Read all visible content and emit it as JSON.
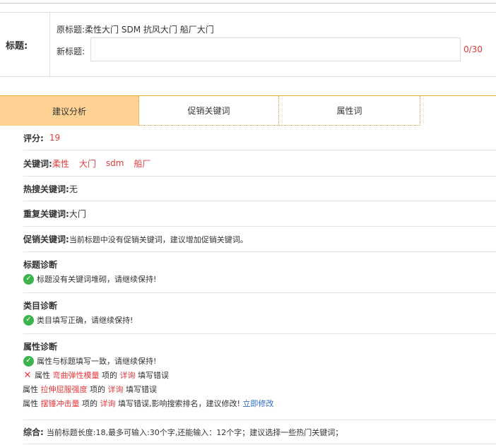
{
  "title_section": {
    "label": "标题:",
    "original_label": "原标题:",
    "original_value": "柔性大门 SDM 抗风大门 船厂大门",
    "new_label": "新标题:",
    "new_value": "",
    "new_placeholder": "",
    "counter": "0/30"
  },
  "tabs": [
    {
      "label": "建议分析",
      "active": true
    },
    {
      "label": "促销关键词",
      "active": false
    },
    {
      "label": "属性词",
      "active": false
    }
  ],
  "score": {
    "label": "评分:",
    "value": "19"
  },
  "keywords": {
    "label": "关键词:",
    "items": [
      "柔性",
      "大门",
      "sdm",
      "船厂"
    ]
  },
  "hot_keywords": {
    "label": "热搜关键词:",
    "value": "无"
  },
  "repeat_keywords": {
    "label": "重复关键词:",
    "value": "大门"
  },
  "promo_keywords": {
    "label": "促销关键词:",
    "value": "当前标题中没有促销关键词，建议增加促销关键词。"
  },
  "title_diag": {
    "heading": "标题诊断",
    "message": "标题没有关键词堆砌，请继续保持!"
  },
  "category_diag": {
    "heading": "类目诊断",
    "message": "类目填写正确，请继续保持!"
  },
  "attr_diag": {
    "heading": "属性诊断",
    "ok_message": "属性与标题填写一致，请继续保持!",
    "prefix": "属性",
    "mid": "项的",
    "detail": "详询",
    "errors": [
      {
        "attr": "弯曲弹性模量",
        "suffix": "填写错误"
      },
      {
        "attr": "拉伸屈服强度",
        "suffix": "填写错误"
      },
      {
        "attr": "摆锤冲击量",
        "suffix": "填写错误,影响搜索排名，建议修改!"
      }
    ],
    "fix_link": "立即修改"
  },
  "summary": {
    "label": "综合:",
    "value": "当前标题长度:18,最多可输入:30个字,还能输入：12个字；建议选择一些热门关键词；"
  },
  "colors": {
    "accent_red": "#e4393c",
    "tab_active_bg": "#fdd293",
    "check_green": "#3cb44b",
    "link_blue": "#2b6bc6"
  },
  "icons": {
    "ok": "check-circle-icon",
    "error": "cross-icon"
  }
}
